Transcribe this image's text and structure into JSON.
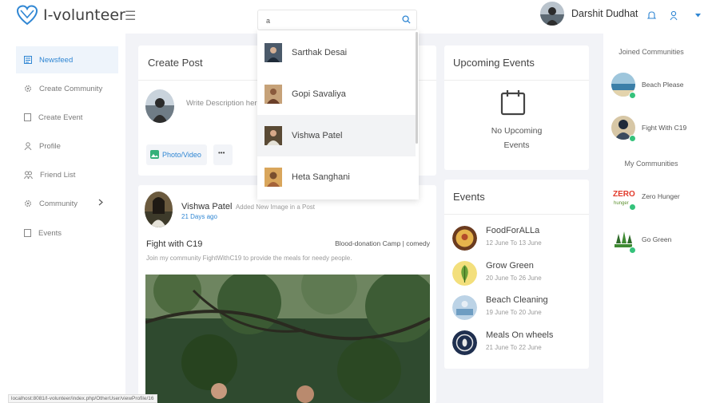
{
  "app": {
    "name": "I-volunteer"
  },
  "search": {
    "value": "a",
    "placeholder": ""
  },
  "search_results": [
    {
      "name": "Sarthak Desai"
    },
    {
      "name": "Gopi Savaliya"
    },
    {
      "name": "Vishwa Patel"
    },
    {
      "name": "Heta Sanghani"
    }
  ],
  "user": {
    "name": "Darshit Dudhat"
  },
  "sidebar": {
    "items": [
      {
        "label": "Newsfeed",
        "icon": "newsfeed-icon",
        "active": true
      },
      {
        "label": "Create Community",
        "icon": "gear-icon"
      },
      {
        "label": "Create Event",
        "icon": "document-icon"
      },
      {
        "label": "Profile",
        "icon": "user-icon"
      },
      {
        "label": "Friend List",
        "icon": "users-icon"
      },
      {
        "label": "Community",
        "icon": "gear-icon"
      },
      {
        "label": "Events",
        "icon": "document-icon"
      }
    ]
  },
  "create_post": {
    "title": "Create Post",
    "placeholder": "Write Description here",
    "photo_video_label": "Photo/Video",
    "more_label": "•••"
  },
  "post": {
    "author": "Vishwa Patel",
    "action": "Added New Image in a Post",
    "time": "21 Days ago",
    "title": "Fight with C19",
    "tags": "Blood-donation Camp | comedy",
    "description": "Join my community FightWithC19 to provide the meals for needy people."
  },
  "upcoming_events": {
    "title": "Upcoming Events",
    "empty_text_line1": "No Upcoming",
    "empty_text_line2": "Events"
  },
  "events": {
    "title": "Events",
    "items": [
      {
        "name": "FoodForALLa",
        "dates": "12 June To 13 June"
      },
      {
        "name": "Grow Green",
        "dates": "20 June To 26 June"
      },
      {
        "name": "Beach Cleaning",
        "dates": "19 June To 20 June"
      },
      {
        "name": "Meals On wheels",
        "dates": "21 June To 22 June"
      }
    ]
  },
  "joined_communities": {
    "title": "Joined Communities",
    "items": [
      {
        "name": "Beach Please"
      },
      {
        "name": "Fight With C19"
      }
    ]
  },
  "my_communities": {
    "title": "My Communities",
    "items": [
      {
        "name": "Zero Hunger"
      },
      {
        "name": "Go Green"
      }
    ]
  },
  "statusbar": {
    "url": "localhost:8081/I-volunteer/index.php/OtherUser/viewProfile/16"
  },
  "colors": {
    "accent": "#2f86d3",
    "online": "#35c27b",
    "background": "#f2f3f7"
  }
}
